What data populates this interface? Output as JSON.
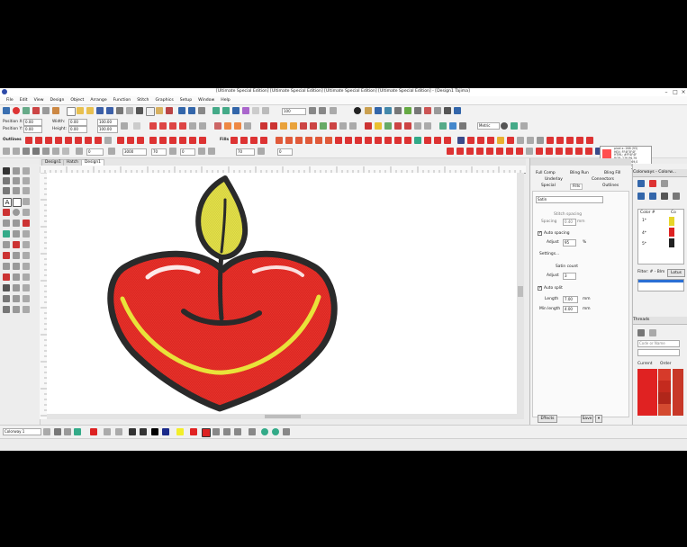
{
  "window": {
    "title": "[Ultimate Special Edition] [Ultimate Special Edition] [Ultimate Special Edition] [Ultimate Special Edition] - [Design1    Tajima]"
  },
  "menu": [
    "File",
    "Edit",
    "View",
    "Design",
    "Object",
    "Arrange",
    "Function",
    "Stitch",
    "Graphics",
    "Setup",
    "Window",
    "Help"
  ],
  "toolbar": {
    "position_x_label": "Position X:",
    "position_x_value": "0.00",
    "position_y_label": "Position Y:",
    "position_y_value": "0.00",
    "width_label": "Width:",
    "width_value": "0.00",
    "height_label": "Height:",
    "height_value": "0.00",
    "size_value1": "100.00",
    "size_value2": "100.00",
    "zoom_value": "100",
    "outlines_label": "Outlines",
    "fills_label": "Fills",
    "metric_value": "Metric",
    "nums": [
      "3000",
      "70",
      "70",
      "0",
      "0",
      "0"
    ]
  },
  "tooltip": {
    "lines": [
      "pixel x: 268 (93)",
      "HEX: FF4F3F4F",
      "HTML: #FF4F4F",
      "RGB: 276,86,79",
      "CMYK: 0,68,69,0",
      "HSV: 2,69,100"
    ]
  },
  "doc_tabs": [
    "Design1",
    "Hatch",
    "Design1"
  ],
  "props": {
    "tab_row1": [
      "Full Comp",
      "Bling Run",
      "Bling Fill"
    ],
    "tab_row2": [
      "Underlay",
      "Connectors"
    ],
    "tab_row3": [
      "Special",
      "Fills",
      "Outlines"
    ],
    "fill_type": "Satin",
    "stitch_spacing_label": "Stitch spacing",
    "spacing_label": "Spacing",
    "spacing_value": "0.40",
    "spacing_unit": "mm",
    "auto_spacing_label": "Auto spacing",
    "adjust_label": "Adjust",
    "adjust_value": "95",
    "adjust_unit": "%",
    "settings_label": "Settings...",
    "satin_count_label": "Satin count",
    "adjust2_value": "3",
    "auto_split_label": "Auto split",
    "length_label": "Length",
    "length_value": "7.00",
    "length_unit": "mm",
    "min_length_label": "Min length",
    "min_length_value": "4.00",
    "min_length_unit": "mm",
    "effects_button": "Effects",
    "save_button": "Save"
  },
  "rpanel": {
    "header": "Colorways - Colorw...",
    "color_header": "Color #",
    "col_header": "Co",
    "rows": [
      "1*",
      "4*",
      "5*"
    ],
    "filter_label": "Filter: # - Blm",
    "lotus_label": "Lotus",
    "threads_header": "Threads",
    "search_placeholder": "Code or Name",
    "current_label": "Current",
    "order_label": "Order"
  },
  "bottom": {
    "colorway_value": "Colorway 1"
  },
  "colors": {
    "canvas_bg": "#ffffff",
    "heart_red": "#e8312a",
    "flame_yellow": "#e3e04a",
    "outline": "#2a2a2a",
    "selected_thread": "#e02222"
  }
}
